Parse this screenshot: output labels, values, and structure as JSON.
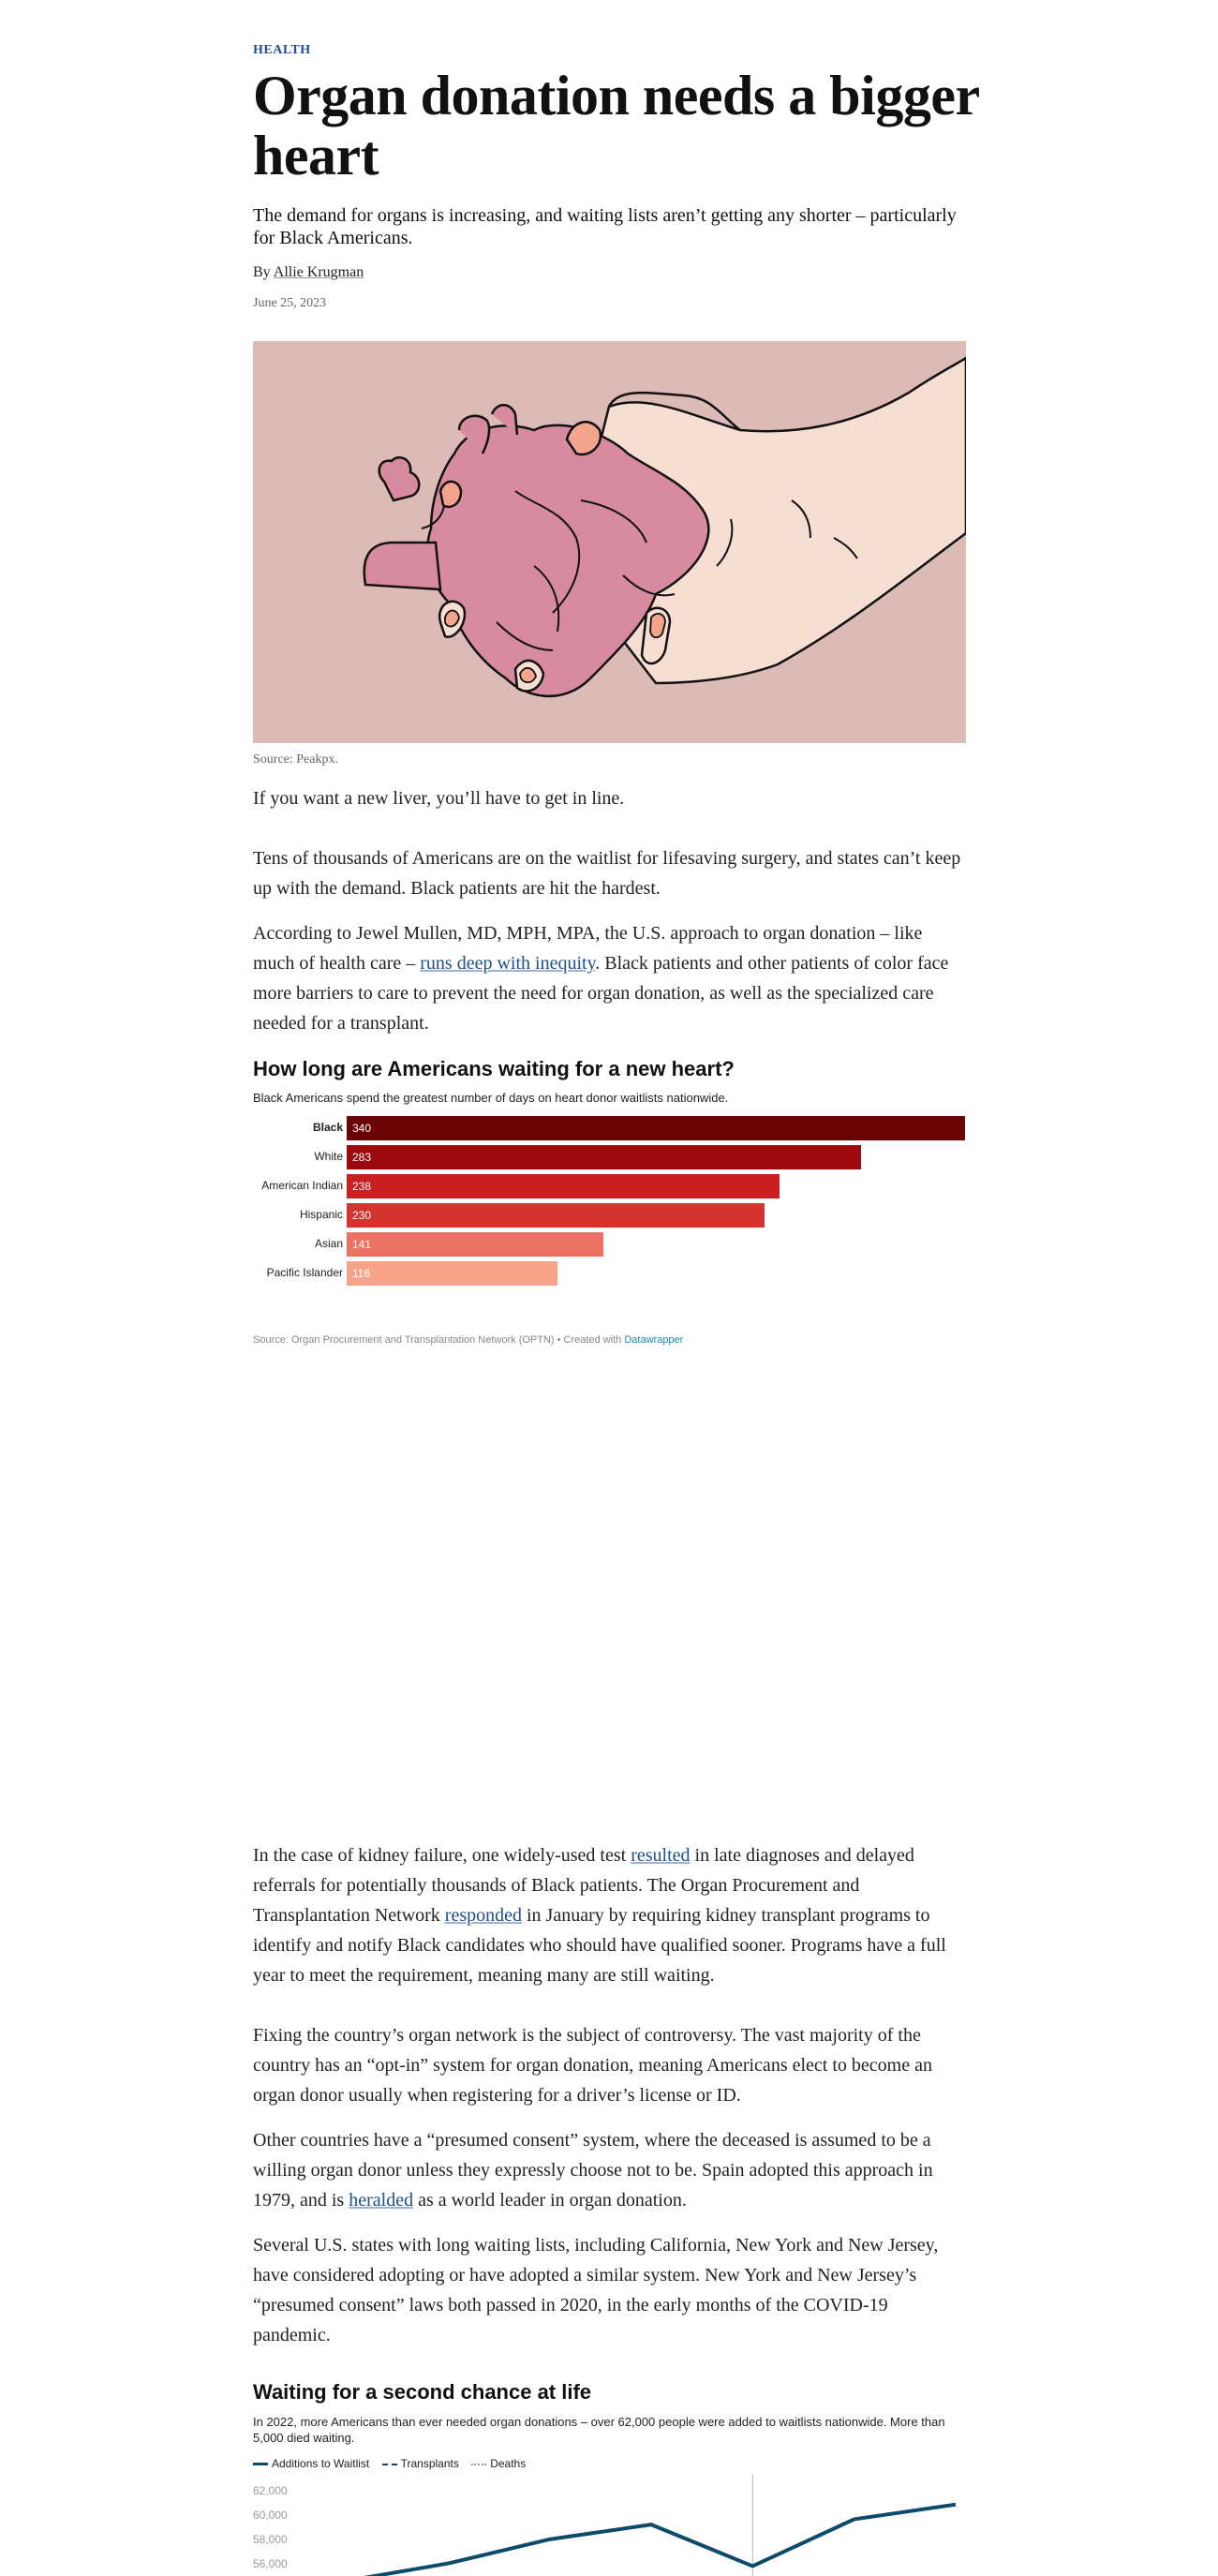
{
  "article": {
    "kicker": "HEALTH",
    "headline": "Organ donation needs a bigger heart",
    "dek": "The demand for organs is increasing, and waiting lists aren’t getting any shorter – particularly for Black Americans.",
    "byline_prefix": "By",
    "author": "Allie Krugman",
    "date": "June 25, 2023",
    "image_caption": "Source: Peakpx."
  },
  "paragraphs": {
    "p1": "If you want a new liver, you’ll have to get in line.",
    "p2": "Tens of thousands of Americans are on the waitlist for lifesaving surgery, and states can’t keep up with the demand. Black patients are hit the hardest.",
    "p3_a": "According to Jewel Mullen, MD, MPH, MPA, the U.S. approach to organ donation – like much of health care – ",
    "p3_link": "runs deep with inequity",
    "p3_b": ". Black patients and other patients of color face more barriers to care to prevent the need for organ donation, as well as the specialized care needed for a transplant.",
    "p4_a": "In the case of kidney failure, one widely-used test ",
    "p4_link1": "resulted",
    "p4_b": " in late diagnoses and delayed referrals for potentially thousands of Black patients. The Organ Procurement and Transplantation Network ",
    "p4_link2": "responded",
    "p4_c": " in January by requiring kidney transplant programs to identify and notify Black candidates who should have qualified sooner. Programs have a full year to meet the requirement, meaning many are still waiting.",
    "p5": "Fixing the country’s organ network is the subject of controversy. The vast majority of the country has an “opt-in” system for organ donation, meaning Americans elect to become an organ donor usually when registering for a driver’s license or ID.",
    "p6_a": "Other countries have a “presumed consent” system, where the deceased is assumed to be a willing organ donor unless they expressly choose not to be. Spain adopted this approach in 1979, and is ",
    "p6_link": "heralded",
    "p6_b": " as a world leader in organ donation.",
    "p7": "Several U.S. states with long waiting lists, including California, New York and New Jersey, have considered adopting or have adopted a similar system. New York and New Jersey’s “presumed consent” laws both passed in 2020, in the early months of the COVID-19 pandemic."
  },
  "chart1_text": {
    "source_prefix": "Source: Organ Procurement and Transplantation Network (OPTN) • Created with ",
    "source_link": "Datawrapper"
  },
  "chart2_text": {
    "legend": [
      "Additions to Waitlist",
      "Transplants",
      "Deaths"
    ],
    "yticks": [
      "62,000",
      "60,000",
      "58,000",
      "56,000"
    ]
  },
  "colors": {
    "link": "#1f4e8c",
    "bars": [
      "#6b0407",
      "#9e0a0e",
      "#c81f22",
      "#d4342e",
      "#ec7263",
      "#f7a38a"
    ],
    "line": "#0d4a6b"
  },
  "chart_data": [
    {
      "type": "bar",
      "title": "How long are Americans waiting for a new heart?",
      "subtitle": "Black Americans spend the greatest number of days on heart donor waitlists nationwide.",
      "categories": [
        "Black",
        "White",
        "American Indian",
        "Hispanic",
        "Asian",
        "Pacific Islander"
      ],
      "values": [
        340,
        283,
        238,
        230,
        141,
        116
      ],
      "xlim": [
        0,
        340
      ]
    },
    {
      "type": "line",
      "title": "Waiting for a second chance at life",
      "subtitle": "In 2022, more Americans than ever needed organ donations – over 62,000 people were added to waitlists nationwide. More than 5,000 died waiting.",
      "series": [
        {
          "name": "Additions to Waitlist",
          "values": [
            55200,
            56500,
            58300,
            59400,
            56300,
            59800,
            60900
          ]
        }
      ],
      "ylim": [
        55000,
        62000
      ]
    }
  ]
}
